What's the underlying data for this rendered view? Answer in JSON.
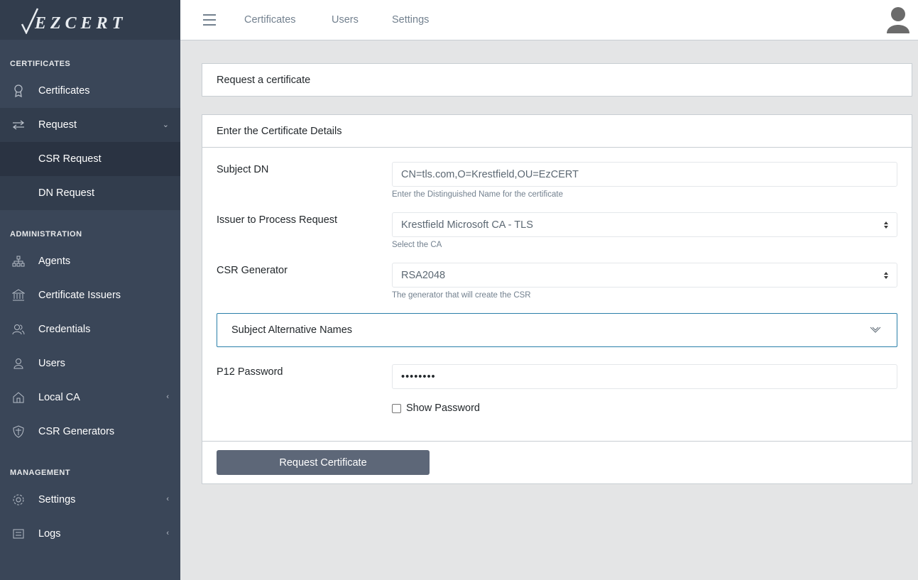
{
  "brand": {
    "name": "EZCERT"
  },
  "sidebar": {
    "sections": {
      "certificates": "CERTIFICATES",
      "administration": "ADMINISTRATION",
      "management": "MANAGEMENT"
    },
    "items": {
      "certificates": "Certificates",
      "request": "Request",
      "csr_request": "CSR Request",
      "dn_request": "DN Request",
      "agents": "Agents",
      "certificate_issuers": "Certificate Issuers",
      "credentials": "Credentials",
      "users": "Users",
      "local_ca": "Local CA",
      "csr_generators": "CSR Generators",
      "settings": "Settings",
      "logs": "Logs"
    }
  },
  "header": {
    "nav": [
      "Certificates",
      "Users",
      "Settings"
    ]
  },
  "page": {
    "title_card": "Request a certificate",
    "details_card": "Enter the Certificate Details",
    "subject_dn": {
      "label": "Subject DN",
      "value": "CN=tls.com,O=Krestfield,OU=EzCERT",
      "help": "Enter the Distinguished Name for the certificate"
    },
    "issuer": {
      "label": "Issuer to Process Request",
      "value": "Krestfield Microsoft CA - TLS",
      "help": "Select the CA"
    },
    "csr_generator": {
      "label": "CSR Generator",
      "value": "RSA2048",
      "help": "The generator that will create the CSR"
    },
    "san": {
      "label": "Subject Alternative Names"
    },
    "p12": {
      "label": "P12 Password",
      "value": "••••••••",
      "show_password": "Show Password",
      "show_password_checked": false
    },
    "submit": "Request Certificate"
  },
  "colors": {
    "sidebar_bg": "#3a4658",
    "brand_bg": "#323d4d",
    "accent_border": "#2a7fa9",
    "button_bg": "#5d6778"
  }
}
